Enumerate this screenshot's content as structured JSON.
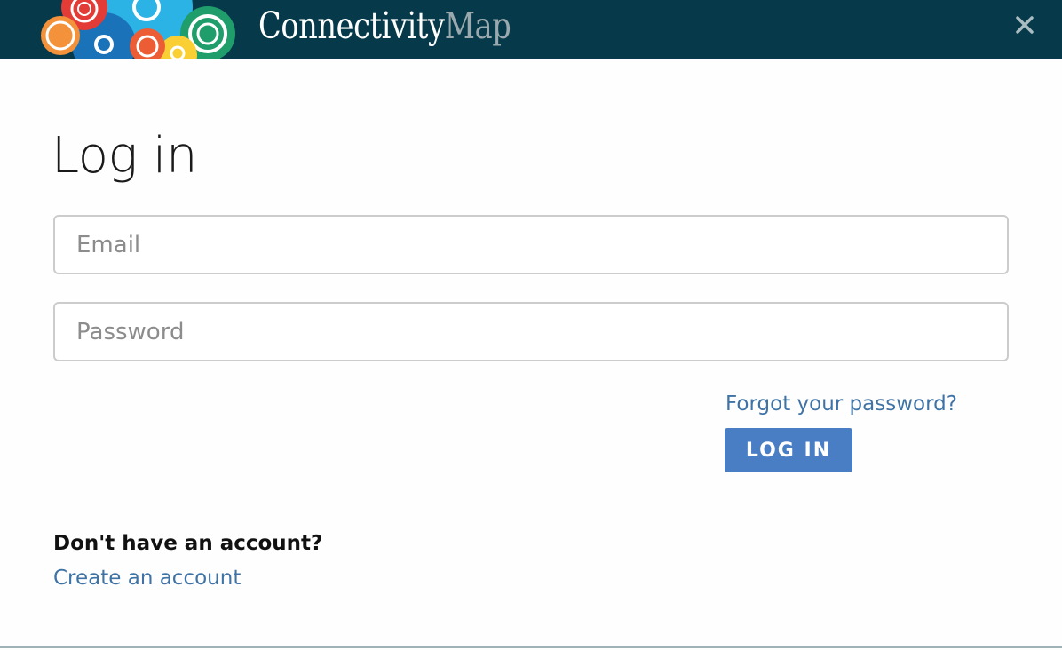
{
  "header": {
    "brand_primary": "Connectivity",
    "brand_secondary": "Map",
    "close_label": "×",
    "background_color": "#063a4a"
  },
  "login": {
    "title": "Log in",
    "email_placeholder": "Email",
    "email_value": "",
    "password_placeholder": "Password",
    "password_value": "",
    "forgot_link": "Forgot your password?",
    "login_button": "LOG IN",
    "button_color": "#4a7ec4",
    "link_color": "#3f73a6"
  },
  "signup": {
    "prompt": "Don't have an account?",
    "create_link": "Create an account"
  },
  "icons": {
    "logo": "connectivity-map-logo-icon",
    "close": "close-icon"
  }
}
